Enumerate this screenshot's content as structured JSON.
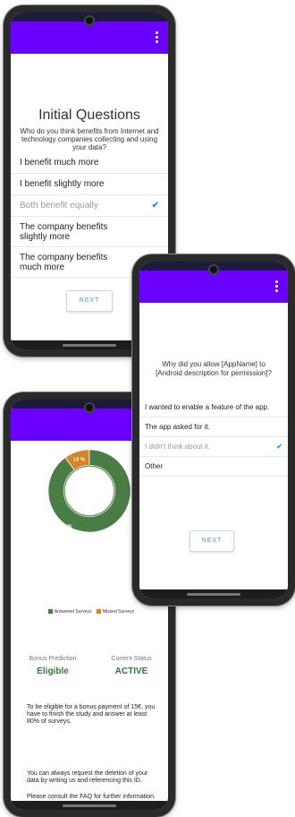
{
  "colors": {
    "app_bar": "#6a00ff",
    "accent_check": "#2196f3",
    "answered": "#4a7c45",
    "missed": "#d4852a",
    "eligible": "#2e7d32"
  },
  "screen1": {
    "title": "Initial Questions",
    "subtitle": "Who do you think benefits from Internet and technology companies collecting and using your data?",
    "options": [
      {
        "label": "I benefit much more",
        "selected": false
      },
      {
        "label": "I benefit slightly more",
        "selected": false
      },
      {
        "label": "Both benefit equally",
        "selected": true
      },
      {
        "label": "The company benefits slightly more",
        "selected": false
      },
      {
        "label": "The company benefits much more",
        "selected": false
      }
    ],
    "next_label": "NEXT",
    "menu_icon": "kebab-menu-icon"
  },
  "screen2": {
    "question": "Why did you allow [AppName] to [Android description for permission]?",
    "options": [
      {
        "label": "I wanted to enable a feature of the app.",
        "selected": false
      },
      {
        "label": "The app asked for it.",
        "selected": false
      },
      {
        "label": "I didn't think about it.",
        "selected": true
      },
      {
        "label": "Other",
        "selected": false
      }
    ],
    "next_label": "NEXT",
    "menu_icon": "kebab-menu-icon"
  },
  "screen3": {
    "chart_data": {
      "type": "pie",
      "categories": [
        "Answered Surveys",
        "Missed Surveys"
      ],
      "values": [
        90,
        10
      ],
      "labels": [
        "90 %",
        "10 %"
      ],
      "legend": "bottom"
    },
    "legend": {
      "answered": "Answered Surveys",
      "missed": "Missed Surveys"
    },
    "bonus_label": "Bonus Prediction",
    "bonus_value": "Eligible",
    "status_label": "Current Status",
    "status_value": "ACTIVE",
    "bonus_info": "To be eligible for a bonus payment of 15€, you have to finish the study and answer at least 80% of surveys.",
    "deletion_info": "You can always request the deletion of your data by writing us and referencing this ID.",
    "faq_info": "Please consult the FAQ for further information."
  }
}
